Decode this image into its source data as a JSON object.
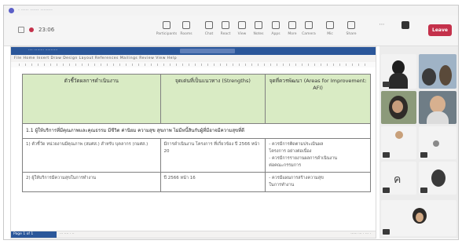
{
  "window": {
    "title": "· ····· ······ ········"
  },
  "toolbar": {
    "timer": "23:06",
    "items": [
      {
        "label": "Participants",
        "icon": "people-icon"
      },
      {
        "label": "Rooms",
        "icon": "rooms-icon"
      },
      {
        "label": "Chat",
        "icon": "chat-icon"
      },
      {
        "label": "React",
        "icon": "react-icon"
      },
      {
        "label": "View",
        "icon": "view-icon"
      },
      {
        "label": "Notes",
        "icon": "notes-icon"
      },
      {
        "label": "Apps",
        "icon": "apps-icon"
      },
      {
        "label": "More",
        "icon": "more-icon"
      },
      {
        "label": "Camera",
        "icon": "camera-icon"
      },
      {
        "label": "Mic",
        "icon": "mic-icon"
      },
      {
        "label": "Share",
        "icon": "share-icon"
      }
    ],
    "leave_label": "Leave"
  },
  "word": {
    "title_text": "···· ········· ···········",
    "menu_text": "File  Home  Insert  Draw  Design  Layout  References  Mailings  Review  View  Help",
    "status_left": "Page 1 of 1",
    "status_mid": "··· ···· · ··",
    "status_right": "······ ···  · ··· ·"
  },
  "table": {
    "headers": [
      "ตัวชี้วัดผลการดำเนินงาน",
      "จุดเด่นที่เป็นแนวทาง (Strengths)",
      "จุดที่ควรพัฒนา (Areas for Improvement: AFI)"
    ],
    "section": "1.1 ผู้ให้บริการที่มีคุณภาพและคุณธรรม มีชีวิต ค่านิยม ความสุข สุขภาพ ไม่มีหนี้สินกับผู้ที่มีอาจมีความสุขที่ดี",
    "rows": [
      {
        "c1": "1) ตัวชี้วัด หน่วยงานมีคุณภาพ (สมศส.) สำหรับ บุคลากร (กมศส.)",
        "c2": "มีการดำเนินงาน โครงการ ที่เกี่ยวข้อง ปี 2566 หน้า 20",
        "c3": [
          "- ควรมีการติดตามประเมินผล",
          "โครงการ อย่างต่อเนื่อง",
          "- ควรมีการรายงานผลการดำเนินงาน",
          "ต่อคณะกรรมการ"
        ]
      },
      {
        "c1": "2) ผู้ให้บริการมีความสุขในการทำงาน",
        "c2": "ปี 2566 หน้า 16",
        "c3": [
          "- ควรมีแผนการสร้างความสุข",
          "ในการทำงาน"
        ]
      }
    ]
  }
}
